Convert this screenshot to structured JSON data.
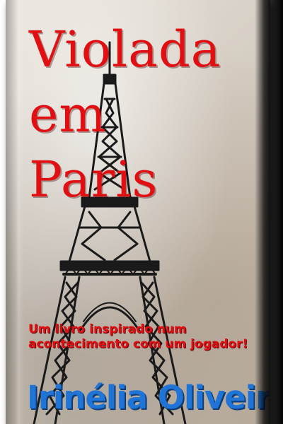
{
  "book": {
    "title_lines": [
      "Violada",
      "em",
      "Paris"
    ],
    "subtitle": "Um livro inspirado num acontecimento com um jogador!",
    "author": "Irinélia Oliveira"
  },
  "colors": {
    "title": "#e10f12",
    "author": "#1f74d6",
    "tower": "#1a1a1a",
    "paper": "#ddd6cc"
  },
  "illustration": "eiffel-tower"
}
